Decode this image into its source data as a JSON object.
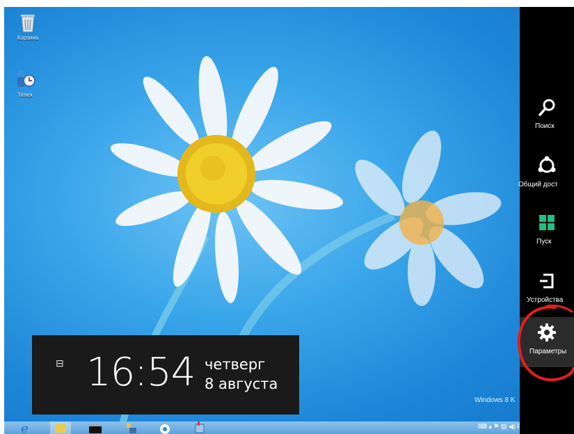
{
  "desktop": {
    "icons": [
      {
        "label": "Корзина",
        "icon": "recycle-bin-icon"
      },
      {
        "label": "Timex",
        "icon": "app-shortcut-icon"
      }
    ],
    "watermark": "Windows 8 K"
  },
  "clock": {
    "time": "16:54",
    "day": "четверг",
    "date": "8 августа",
    "network_icon": "network-icon"
  },
  "charms": {
    "items": [
      {
        "label": "Поиск",
        "icon": "search-icon"
      },
      {
        "label": "Общий дост",
        "icon": "share-icon"
      },
      {
        "label": "Пуск",
        "icon": "windows-start-icon"
      },
      {
        "label": "Устройства",
        "icon": "devices-icon"
      },
      {
        "label": "Параметры",
        "icon": "settings-gear-icon"
      }
    ],
    "active": "Параметры",
    "highlight_color": "#e0201c"
  },
  "taskbar": {
    "buttons": [
      "internet-explorer-icon",
      "file-explorer-icon",
      "command-prompt-icon",
      "server-manager-icon",
      "media-icon",
      "network-tool-icon"
    ],
    "tray_text": "РУ"
  }
}
